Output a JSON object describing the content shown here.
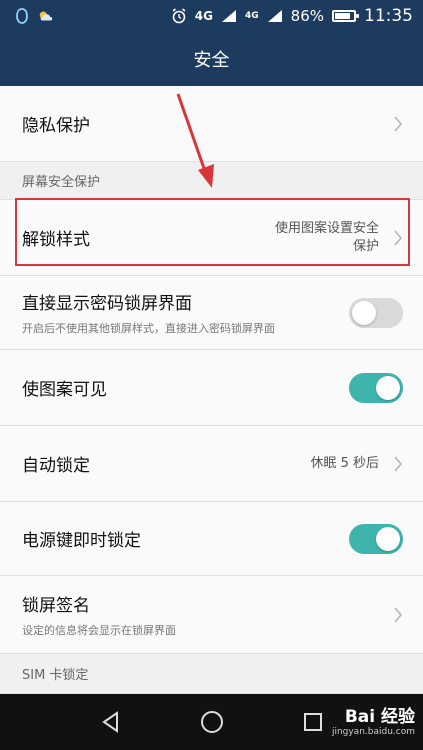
{
  "status_bar": {
    "network_4g": "4G",
    "network_4g_alt": "4G",
    "battery_percent": "86%",
    "battery_level": 0.86,
    "time": "11:35"
  },
  "header": {
    "title": "安全"
  },
  "rows": {
    "privacy": {
      "title": "隐私保护"
    },
    "section_screen": "屏幕安全保护",
    "unlock_style": {
      "title": "解锁样式",
      "value_line1": "使用图案设置安全",
      "value_line2": "保护"
    },
    "direct_password": {
      "title": "直接显示密码锁屏界面",
      "subtitle": "开启后不使用其他锁屏样式，直接进入密码锁屏界面",
      "toggle": false
    },
    "pattern_visible": {
      "title": "使图案可见",
      "toggle": true
    },
    "auto_lock": {
      "title": "自动锁定",
      "value": "休眠 5 秒后"
    },
    "power_lock": {
      "title": "电源键即时锁定",
      "toggle": true
    },
    "lock_signature": {
      "title": "锁屏签名",
      "subtitle": "设定的信息将会显示在锁屏界面"
    },
    "section_sim": "SIM 卡锁定"
  },
  "watermark": {
    "brand": "Bai 经验",
    "url": "jingyan.baidu.com"
  },
  "colors": {
    "header": "#1d3a5f",
    "toggle_on": "#3db5ad",
    "highlight": "#d9363b"
  }
}
